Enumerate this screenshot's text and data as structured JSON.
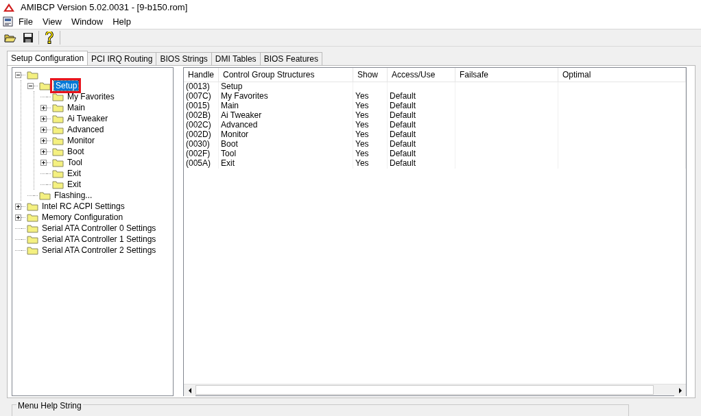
{
  "window": {
    "title": "AMIBCP Version 5.02.0031 - [9-b150.rom]"
  },
  "menu": [
    "File",
    "View",
    "Window",
    "Help"
  ],
  "tabs": [
    {
      "label": "Setup Configuration",
      "selected": true
    },
    {
      "label": "PCI IRQ Routing",
      "selected": false
    },
    {
      "label": "BIOS Strings",
      "selected": false
    },
    {
      "label": "DMI Tables",
      "selected": false
    },
    {
      "label": "BIOS Features",
      "selected": false
    }
  ],
  "tree": [
    {
      "expanded": true,
      "children": [
        {
          "label": "Setup",
          "expanded": true,
          "selected": true,
          "annotated": true,
          "children": [
            {
              "label": "My Favorites",
              "selected": false
            },
            {
              "label": "Main",
              "expanded": false,
              "selected": false
            },
            {
              "label": "Ai Tweaker",
              "expanded": false,
              "selected": false
            },
            {
              "label": "Advanced",
              "expanded": false,
              "selected": false
            },
            {
              "label": "Monitor",
              "expanded": false,
              "selected": false
            },
            {
              "label": "Boot",
              "expanded": false,
              "selected": false
            },
            {
              "label": "Tool",
              "expanded": false,
              "selected": false
            },
            {
              "label": "Exit",
              "selected": false
            },
            {
              "label": "Exit",
              "selected": false
            }
          ]
        },
        {
          "label": "Flashing...",
          "selected": false
        }
      ]
    },
    {
      "label": "Intel RC ACPI Settings",
      "expanded": false,
      "selected": false
    },
    {
      "label": "Memory Configuration",
      "expanded": false,
      "selected": false
    },
    {
      "label": "Serial ATA Controller 0 Settings",
      "selected": false
    },
    {
      "label": "Serial ATA Controller 1 Settings",
      "selected": false
    },
    {
      "label": "Serial ATA Controller 2 Settings",
      "selected": false
    }
  ],
  "table": {
    "columns": [
      "Handle",
      "Control Group Structures",
      "Show",
      "Access/Use",
      "Failsafe",
      "Optimal"
    ],
    "rows": [
      [
        "(0013)",
        "Setup",
        "",
        "",
        "",
        ""
      ],
      [
        "(007C)",
        "My Favorites",
        "Yes",
        "Default",
        "",
        ""
      ],
      [
        "(0015)",
        "Main",
        "Yes",
        "Default",
        "",
        ""
      ],
      [
        "(002B)",
        "Ai Tweaker",
        "Yes",
        "Default",
        "",
        ""
      ],
      [
        "(002C)",
        "Advanced",
        "Yes",
        "Default",
        "",
        ""
      ],
      [
        "(002D)",
        "Monitor",
        "Yes",
        "Default",
        "",
        ""
      ],
      [
        "(0030)",
        "Boot",
        "Yes",
        "Default",
        "",
        ""
      ],
      [
        "(002F)",
        "Tool",
        "Yes",
        "Default",
        "",
        ""
      ],
      [
        "(005A)",
        "Exit",
        "Yes",
        "Default",
        "",
        ""
      ]
    ]
  },
  "help_group": {
    "title": "Menu Help String"
  }
}
